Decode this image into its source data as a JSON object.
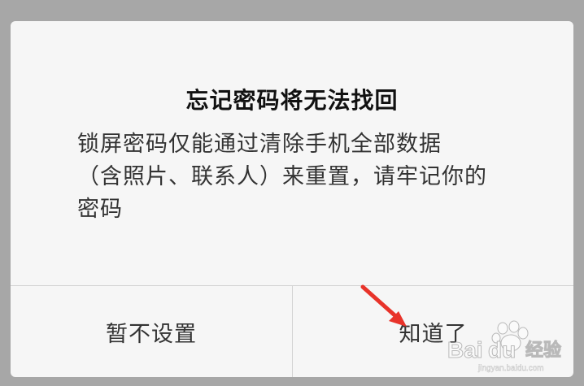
{
  "dialog": {
    "title": "忘记密码将无法找回",
    "message_lines": [
      "锁屏密码仅能通过清除手机全部数据",
      "（含照片、联系人）来重置，请牢记你的",
      "密码"
    ],
    "buttons": {
      "cancel_label": "暂不设置",
      "confirm_label": "知道了"
    }
  },
  "overlay": {
    "arrow_icon": "red-arrow-icon",
    "watermark": "Baidu经验",
    "watermark_url": "jingyan.baidu.com"
  },
  "colors": {
    "backdrop": "#a7a7a7",
    "dialog_bg": "#f6f6f6",
    "divider": "#d3d3d3",
    "arrow": "#e8332a"
  }
}
